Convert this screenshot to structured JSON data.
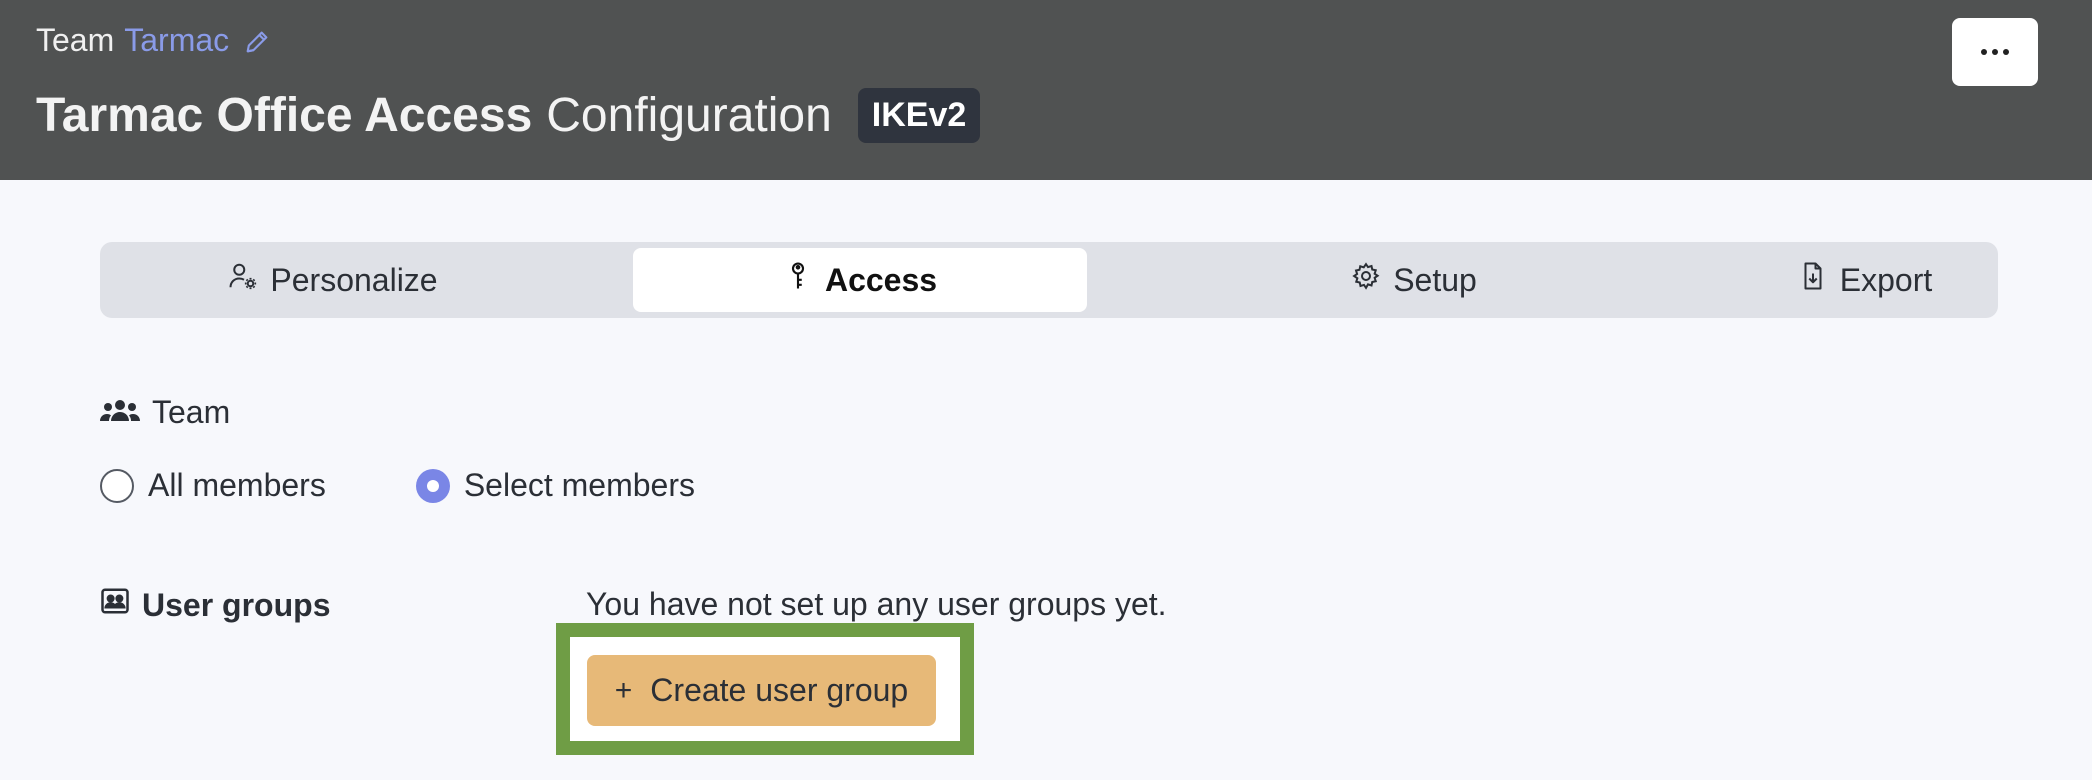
{
  "header": {
    "team_prefix": "Team",
    "team_name": "Tarmac",
    "title_bold": "Tarmac Office Access",
    "title_light": "Configuration",
    "badge": "IKEv2",
    "edit_icon": "pencil-icon",
    "menu_icon": "more-horizontal-icon"
  },
  "tabs": [
    {
      "label": "Personalize",
      "icon": "user-settings-icon",
      "active": false
    },
    {
      "label": "Access",
      "icon": "key-icon",
      "active": true
    },
    {
      "label": "Setup",
      "icon": "gear-icon",
      "active": false
    },
    {
      "label": "Export",
      "icon": "file-export-icon",
      "active": false
    }
  ],
  "team_section": {
    "heading": "Team",
    "icon": "users-icon",
    "options": [
      {
        "label": "All members",
        "selected": false
      },
      {
        "label": "Select members",
        "selected": true
      }
    ]
  },
  "user_groups": {
    "heading": "User groups",
    "icon": "user-group-card-icon",
    "empty_message": "You have not set up any user groups yet.",
    "create_label": "Create user group",
    "create_icon": "+"
  },
  "colors": {
    "header_bg": "#505252",
    "accent": "#7a86e6",
    "team_link": "#8a9be8",
    "create_button": "#e7b978",
    "highlight": "#6f9d45"
  }
}
